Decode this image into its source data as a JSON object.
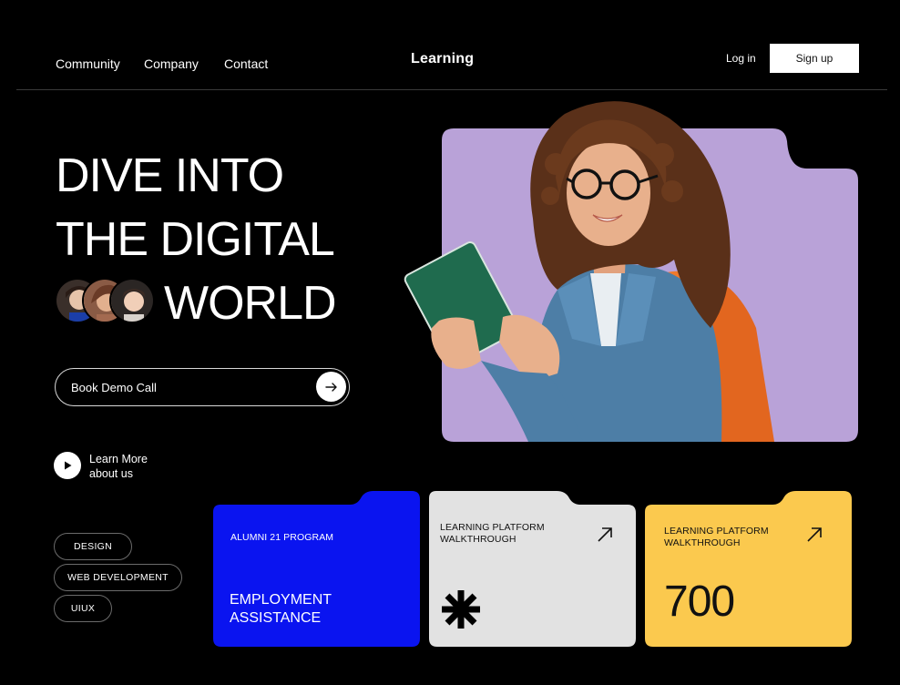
{
  "nav": {
    "links": [
      "Community",
      "Company",
      "Contact"
    ],
    "brand": "Learning",
    "login": "Log in",
    "signup": "Sign up"
  },
  "hero": {
    "line1": "DIVE INTO",
    "line2": "THE DIGITAL",
    "line3": "WORLD",
    "cta": "Book Demo Call",
    "learn_more_line1": "Learn More",
    "learn_more_line2": "about us"
  },
  "tags": [
    "DESIGN",
    "WEB DEVELOPMENT",
    "UIUX"
  ],
  "cards": [
    {
      "small": "ALUMNI 21 PROGRAM",
      "big_line1": "EMPLOYMENT",
      "big_line2": "ASSISTANCE"
    },
    {
      "small_line1": "LEARNING PLATFORM",
      "small_line2": "WALKTHROUGH",
      "icon": "asterisk-icon"
    },
    {
      "small_line1": "LEARNING PLATFORM",
      "small_line2": "WALKTHROUGH",
      "number": "700"
    }
  ],
  "colors": {
    "background": "#000000",
    "hero_panel": "#b9a2d8",
    "card_blue": "#0a14f0",
    "card_gray": "#e2e2e2",
    "card_yellow": "#fbc94e"
  }
}
